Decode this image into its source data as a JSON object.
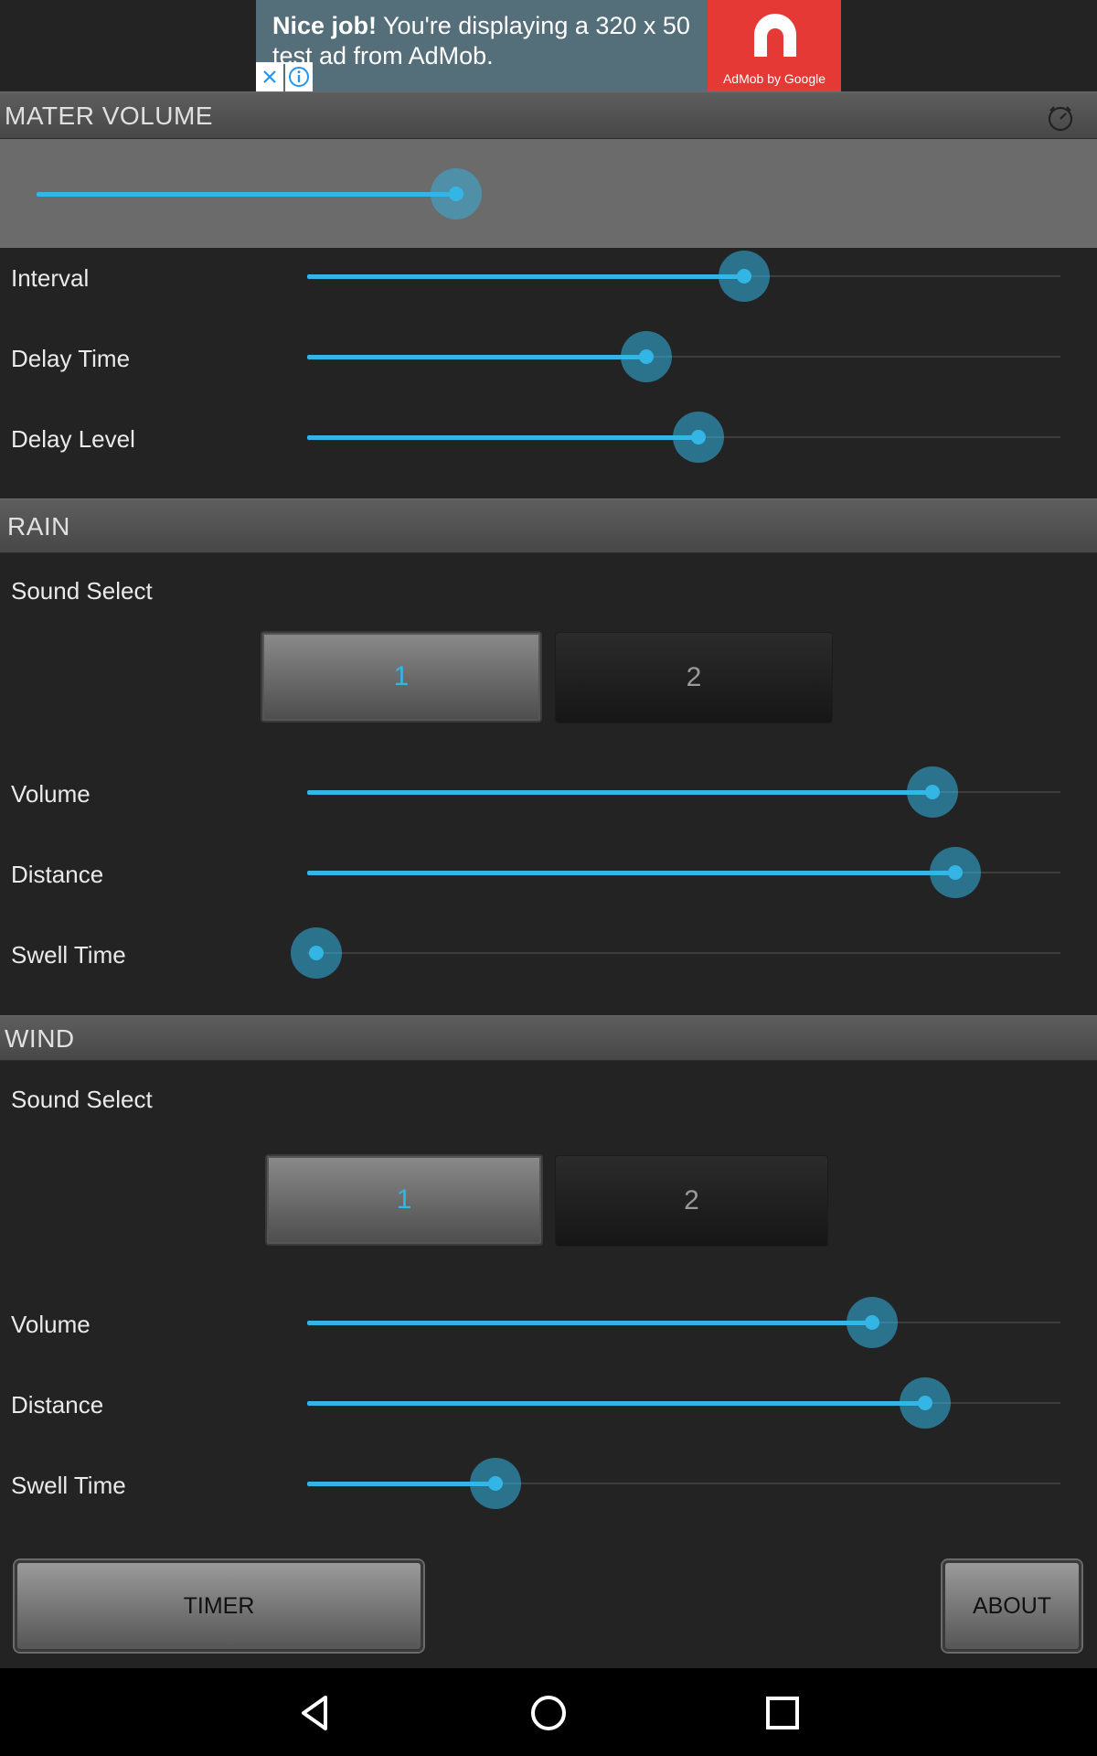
{
  "ad": {
    "headline": "Nice job!",
    "body": " You're displaying a 320 x 50 test ad from AdMob.",
    "logo_caption": "AdMob by Google",
    "close_icon": "close-icon",
    "info_icon": "info-icon"
  },
  "master": {
    "title": "MATER VOLUME",
    "timer_icon": "timer-icon",
    "volume_pct": 82,
    "rows": [
      {
        "label": "Interval",
        "value_pct": 58
      },
      {
        "label": "Delay Time",
        "value_pct": 45
      },
      {
        "label": "Delay Level",
        "value_pct": 52
      }
    ]
  },
  "rain": {
    "title": "RAIN",
    "sound_select_label": "Sound Select",
    "sound_options": [
      "1",
      "2"
    ],
    "selected_sound": "1",
    "rows": [
      {
        "label": "Volume",
        "value_pct": 83
      },
      {
        "label": "Distance",
        "value_pct": 86
      },
      {
        "label": "Swell Time",
        "value_pct": 0
      }
    ]
  },
  "wind": {
    "title": "WIND",
    "sound_select_label": "Sound Select",
    "sound_options": [
      "1",
      "2"
    ],
    "selected_sound": "1",
    "rows": [
      {
        "label": "Volume",
        "value_pct": 75
      },
      {
        "label": "Distance",
        "value_pct": 82
      },
      {
        "label": "Swell Time",
        "value_pct": 25
      }
    ]
  },
  "buttons": {
    "timer": "TIMER",
    "about": "ABOUT"
  },
  "nav": {
    "back_icon": "back-icon",
    "home_icon": "home-icon",
    "recents_icon": "recents-icon"
  },
  "colors": {
    "accent": "#33b5e5",
    "background": "#232323",
    "header": "#515151",
    "ad_red": "#e53935",
    "ad_blue_grey": "#546e7a"
  }
}
